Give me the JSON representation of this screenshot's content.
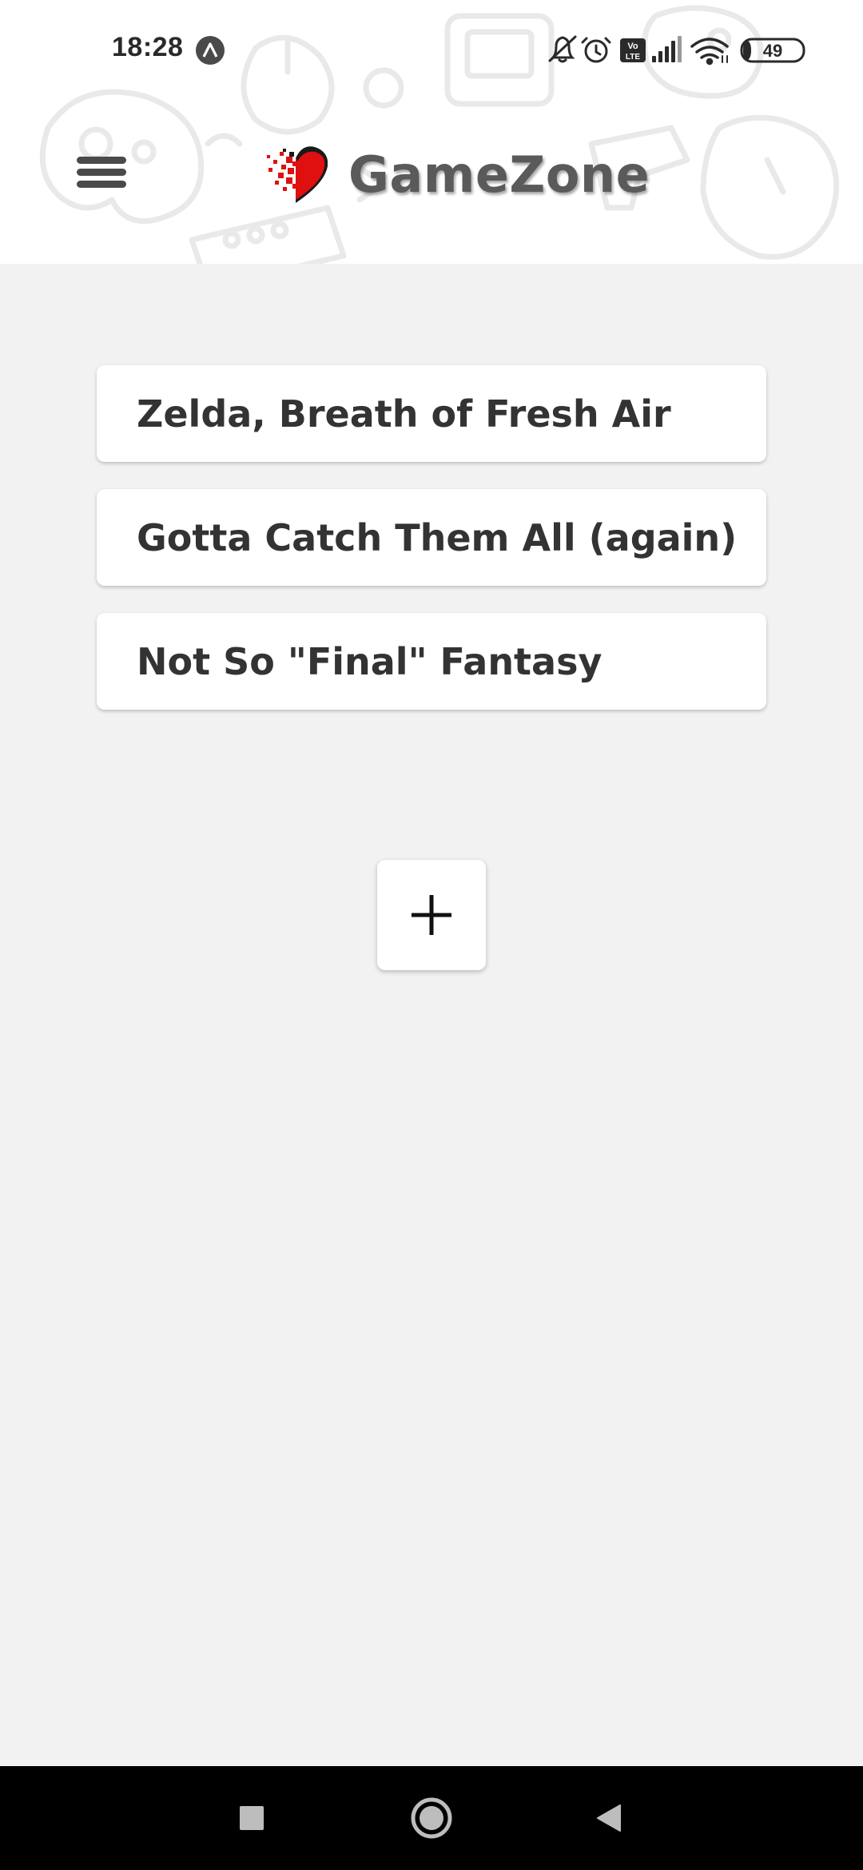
{
  "status_bar": {
    "time": "18:28",
    "battery": "49",
    "icons": [
      "expo-app-icon",
      "mute-icon",
      "alarm-icon",
      "volte-icon",
      "signal-icon",
      "wifi-icon",
      "battery-icon"
    ]
  },
  "app_bar": {
    "title": "GameZone",
    "menu_icon": "hamburger-menu-icon",
    "logo_icon": "pixel-heart-icon"
  },
  "games": [
    {
      "title": "Zelda, Breath of Fresh Air"
    },
    {
      "title": "Gotta Catch Them All (again)"
    },
    {
      "title": "Not So \"Final\" Fantasy"
    }
  ],
  "add_button": {
    "icon": "plus-icon"
  },
  "nav_bar": {
    "buttons": [
      "recents-square-icon",
      "home-circle-icon",
      "back-triangle-icon"
    ]
  },
  "colors": {
    "background": "#f2f2f2",
    "header": "#ffffff",
    "title_text": "#5a5a5a",
    "card_text": "#333333",
    "heart_red": "#e01010",
    "nav_bar": "#000000"
  }
}
